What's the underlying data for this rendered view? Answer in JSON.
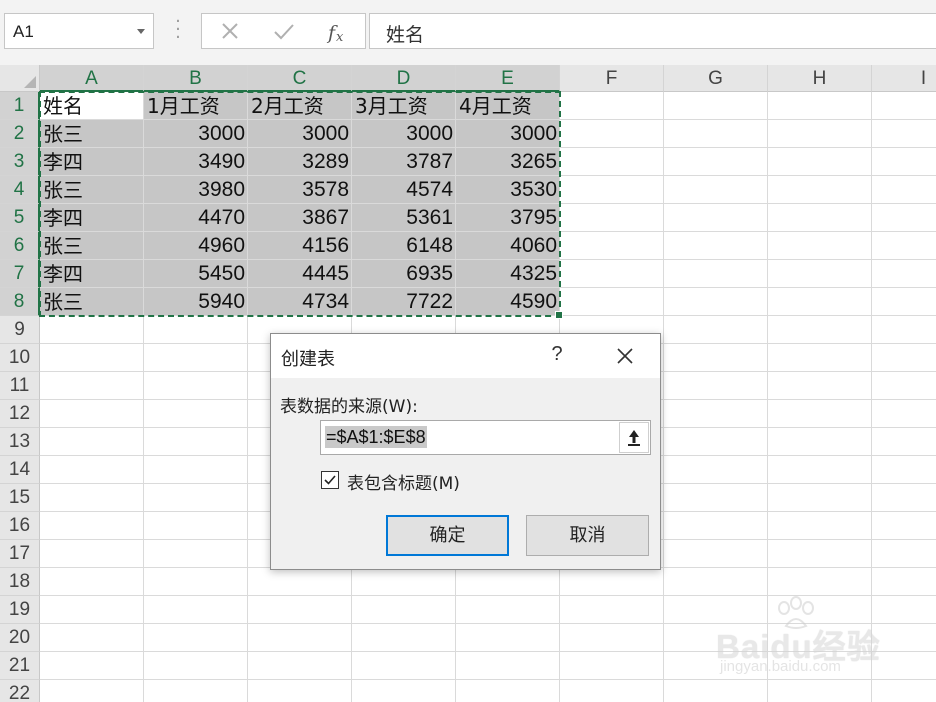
{
  "formula_bar": {
    "name_box": "A1",
    "formula": "姓名",
    "icons": [
      "cancel-x-icon",
      "enter-check-icon",
      "insert-function-icon"
    ]
  },
  "columns": [
    "A",
    "B",
    "C",
    "D",
    "E",
    "F",
    "G",
    "H",
    "I"
  ],
  "rows": [
    "1",
    "2",
    "3",
    "4",
    "5",
    "6",
    "7",
    "8",
    "9",
    "10",
    "11",
    "12",
    "13",
    "14",
    "15",
    "16",
    "17",
    "18",
    "19",
    "20",
    "21",
    "22"
  ],
  "sheet": {
    "header": [
      "姓名",
      "1月工资",
      "2月工资",
      "3月工资",
      "4月工资"
    ],
    "data": [
      [
        "张三",
        "3000",
        "3000",
        "3000",
        "3000"
      ],
      [
        "李四",
        "3490",
        "3289",
        "3787",
        "3265"
      ],
      [
        "张三",
        "3980",
        "3578",
        "4574",
        "3530"
      ],
      [
        "李四",
        "4470",
        "3867",
        "5361",
        "3795"
      ],
      [
        "张三",
        "4960",
        "4156",
        "6148",
        "4060"
      ],
      [
        "李四",
        "5450",
        "4445",
        "6935",
        "4325"
      ],
      [
        "张三",
        "5940",
        "4734",
        "7722",
        "4590"
      ]
    ]
  },
  "dialog": {
    "title": "创建表",
    "help": "?",
    "source_label": "表数据的来源(W):",
    "range": "=$A$1:$E$8",
    "has_headers_label": "表包含标题(M)",
    "has_headers_checked": true,
    "ok_label": "确定",
    "cancel_label": "取消"
  },
  "watermark": {
    "brand": "Baidu经验",
    "url": "jingyan.baidu.com"
  },
  "colors": {
    "selection_accent": "#217346",
    "ok_button_border": "#0078d7"
  }
}
